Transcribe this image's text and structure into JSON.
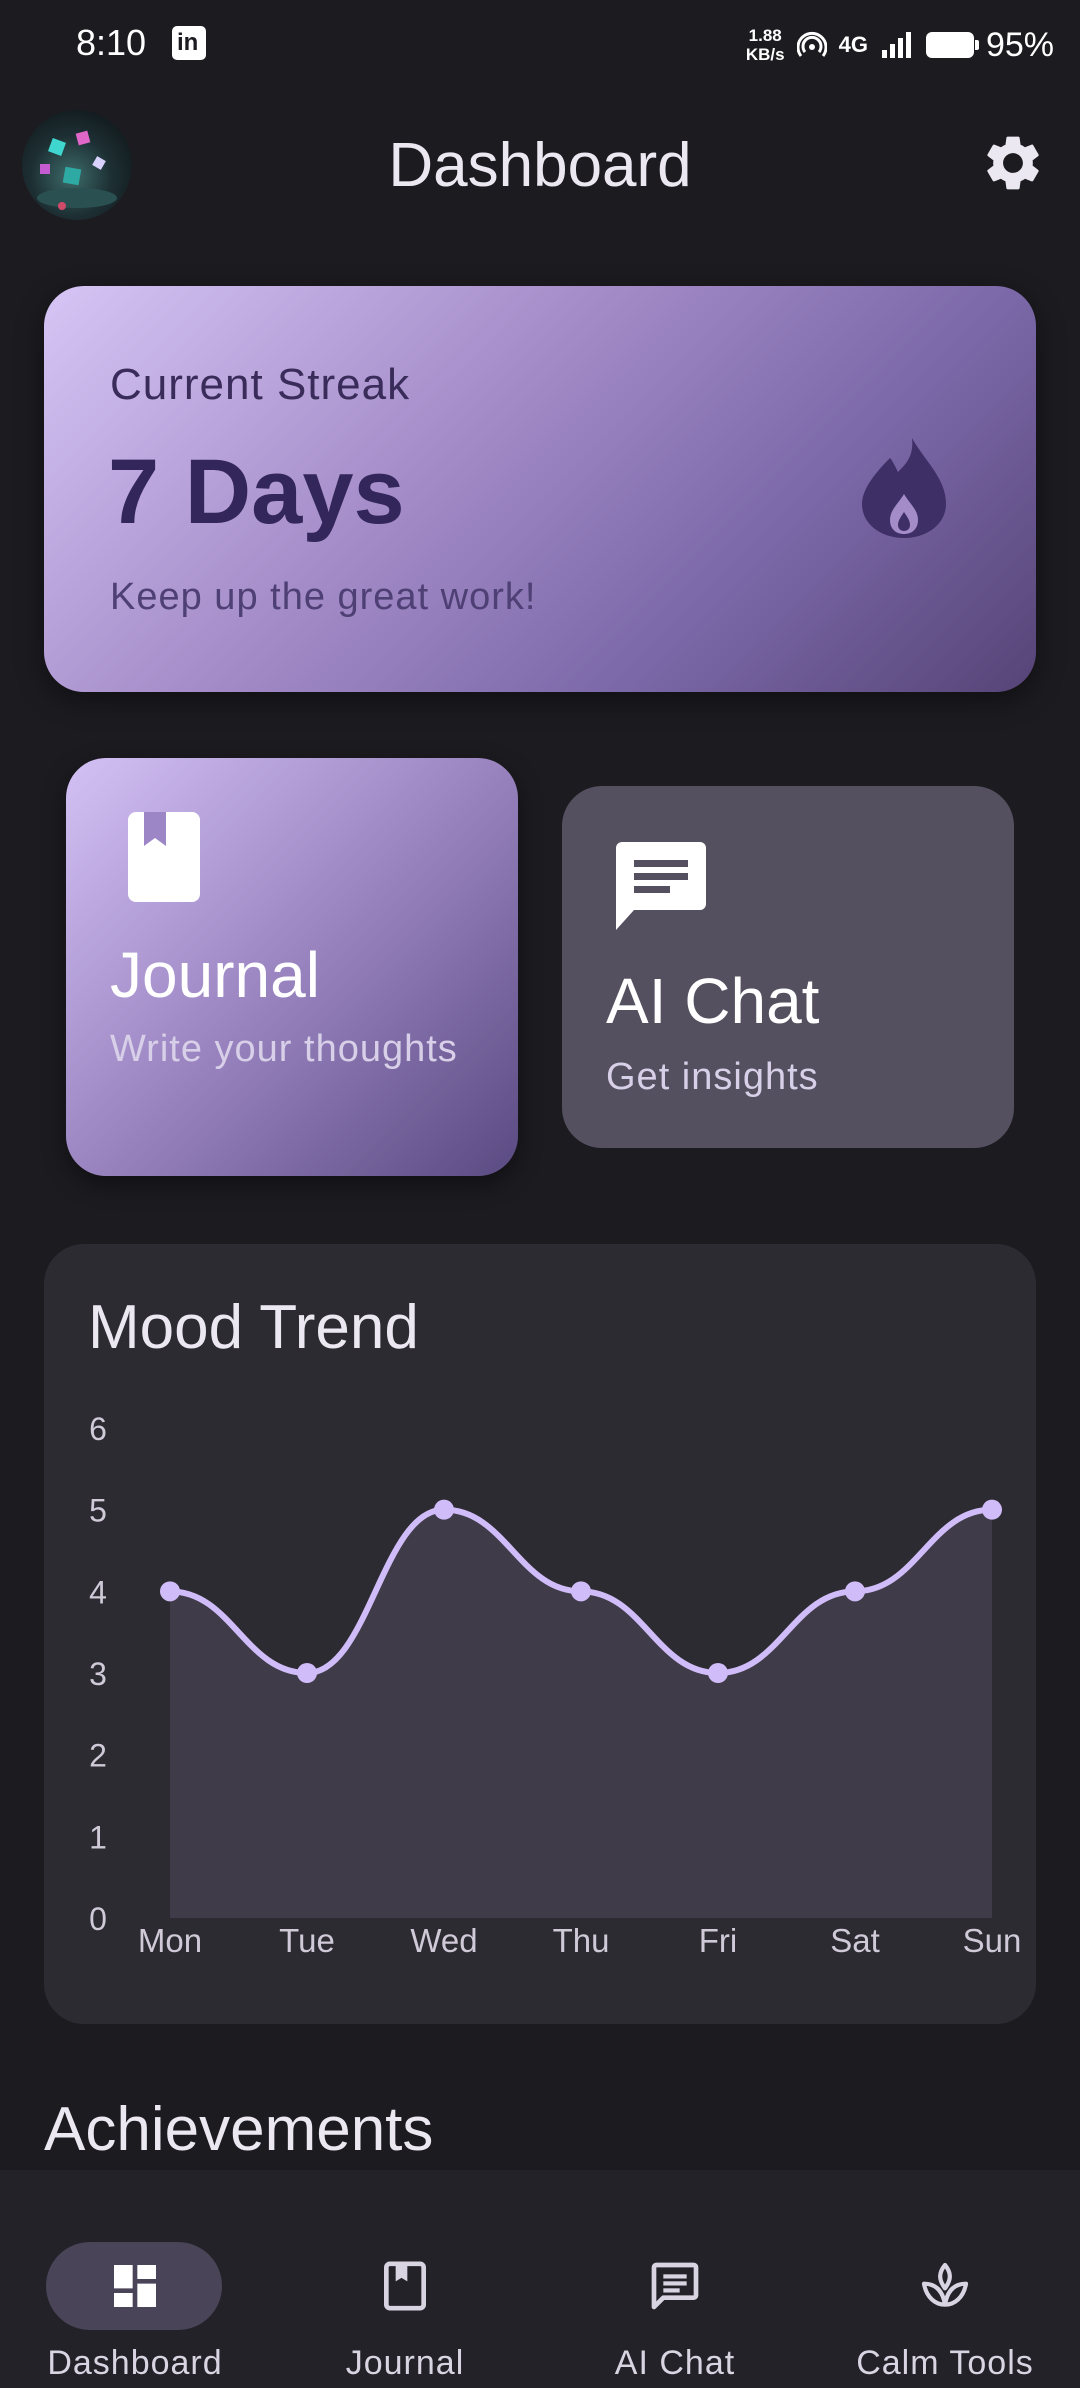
{
  "status_bar": {
    "time": "8:10",
    "speed_value": "1.88",
    "speed_unit": "KB/s",
    "network": "4G",
    "battery": "95%"
  },
  "app_bar": {
    "title": "Dashboard",
    "settings_icon": "gear-icon",
    "avatar": "user-avatar"
  },
  "streak": {
    "label": "Current Streak",
    "value": "7 Days",
    "subtitle": "Keep up the great work!",
    "icon": "fire-icon"
  },
  "quick_actions": [
    {
      "title": "Journal",
      "subtitle": "Write your thoughts",
      "icon": "book-icon"
    },
    {
      "title": "AI Chat",
      "subtitle": "Get insights",
      "icon": "chat-icon"
    }
  ],
  "mood_trend": {
    "title": "Mood Trend"
  },
  "chart_data": {
    "type": "line",
    "title": "Mood Trend",
    "categories": [
      "Mon",
      "Tue",
      "Wed",
      "Thu",
      "Fri",
      "Sat",
      "Sun"
    ],
    "values": [
      4,
      3,
      5,
      4,
      3,
      4,
      5
    ],
    "ylim": [
      0,
      6
    ],
    "yticks": [
      "0",
      "1",
      "2",
      "3",
      "4",
      "5",
      "6"
    ],
    "area_fill": true,
    "grid": false,
    "line_color": "#d0bcf8",
    "fill_color": "#3f3b48"
  },
  "achievements": {
    "title": "Achievements"
  },
  "bottom_nav": [
    {
      "label": "Dashboard",
      "icon": "dashboard-icon",
      "active": true
    },
    {
      "label": "Journal",
      "icon": "book-outline-icon",
      "active": false
    },
    {
      "label": "AI Chat",
      "icon": "chat-outline-icon",
      "active": false
    },
    {
      "label": "Calm Tools",
      "icon": "lotus-icon",
      "active": false
    }
  ],
  "colors": {
    "background": "#1c1b20",
    "accent": "#d0bcf8",
    "card_surface": "#2c2b31"
  }
}
